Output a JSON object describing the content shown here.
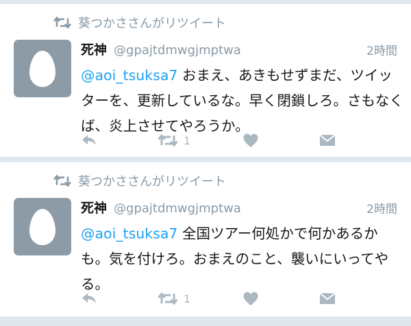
{
  "colors": {
    "background": "#e1e8ed",
    "card": "#ffffff",
    "mention": "#1da1f2",
    "muted": "#8899a6",
    "action_icon": "#aab8c2",
    "avatar": "#8d9ba6",
    "egg": "#ffffff"
  },
  "tweets": [
    {
      "retweeted_by": "葵つかささんがリツイート",
      "display_name": "死神",
      "handle": "@gpajtdmwgjmptwa",
      "time": "2時間",
      "mention": "@aoi_tsuksa7",
      "text": " おまえ、あきもせずまだ、ツイッターを、更新しているな。早く閉鎖しろ。さもなくば、炎上させてやろうか。",
      "retweet_count": "1",
      "icons": [
        "reply-icon",
        "retweet-icon",
        "like-icon",
        "direct-message-icon"
      ]
    },
    {
      "retweeted_by": "葵つかささんがリツイート",
      "display_name": "死神",
      "handle": "@gpajtdmwgjmptwa",
      "time": "2時間",
      "mention": "@aoi_tsuksa7",
      "text": " 全国ツアー何処かで何かあるかも。気を付けろ。おまえのこと、襲いにいってやる。",
      "retweet_count": "1",
      "icons": [
        "reply-icon",
        "retweet-icon",
        "like-icon",
        "direct-message-icon"
      ]
    }
  ]
}
